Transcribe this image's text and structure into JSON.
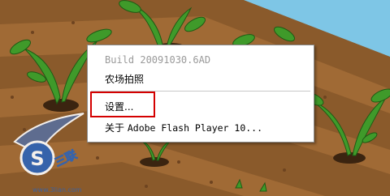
{
  "context_menu": {
    "items": [
      {
        "label": "Build 20091030.6AD",
        "enabled": false
      },
      {
        "label": "农场拍照",
        "enabled": true
      },
      {
        "label": "设置...",
        "enabled": true
      },
      {
        "label_cn": "关于",
        "label_en": "Adobe Flash Player 10...",
        "enabled": true
      }
    ]
  },
  "logo": {
    "glyph": "S",
    "text": "三联"
  },
  "watermark": "www.3lian.com",
  "colors": {
    "menu_bg": "#ffffff",
    "disabled_text": "#9a9a9a",
    "highlight_box": "#d40000",
    "sky": "#7ec6e6",
    "soil": "#8a5a2b",
    "leaf": "#3f9a2a"
  }
}
